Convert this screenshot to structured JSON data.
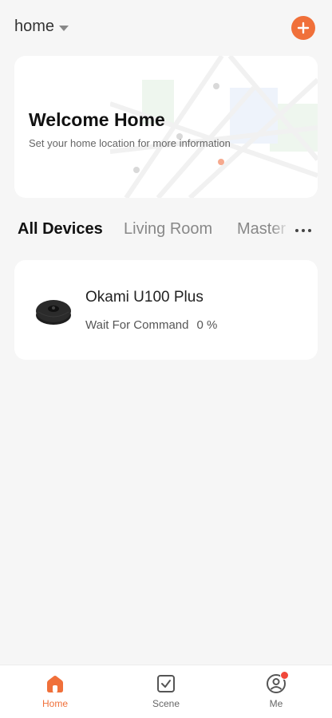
{
  "header": {
    "home_name": "home",
    "add_icon": "plus-icon",
    "accent_color": "#f0703a"
  },
  "welcome": {
    "title": "Welcome Home",
    "subtitle": "Set your home location for more information"
  },
  "tabs": [
    {
      "label": "All Devices",
      "active": true
    },
    {
      "label": "Living Room",
      "active": false
    },
    {
      "label": "Master b",
      "active": false
    }
  ],
  "more_icon": "more-horizontal-icon",
  "devices": [
    {
      "name": "Okami U100 Plus",
      "status": "Wait For Command",
      "battery": "0 %",
      "icon": "robot-vacuum-icon"
    }
  ],
  "bottom_nav": [
    {
      "label": "Home",
      "icon": "home-icon",
      "active": true
    },
    {
      "label": "Scene",
      "icon": "checkbox-icon",
      "active": false
    },
    {
      "label": "Me",
      "icon": "user-icon",
      "active": false,
      "badge": true
    }
  ]
}
